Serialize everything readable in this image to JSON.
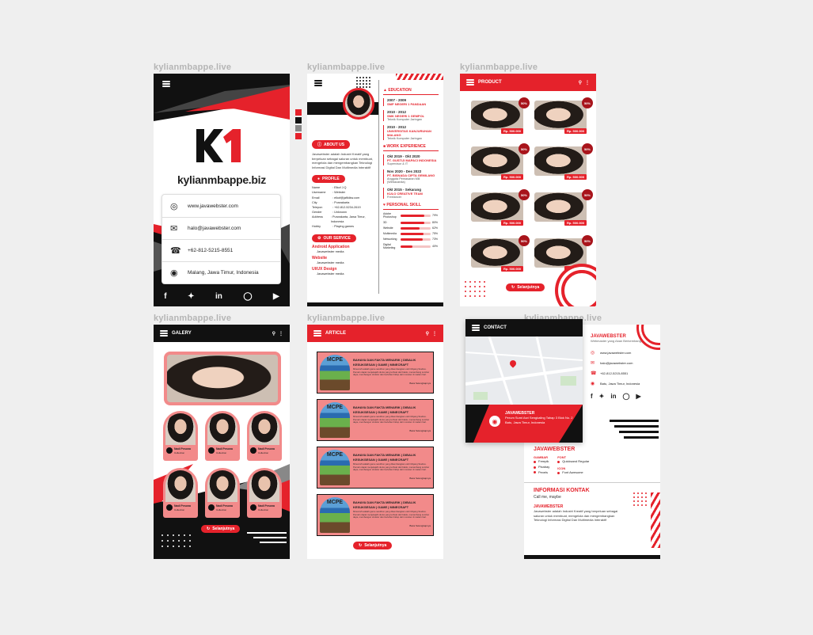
{
  "watermarks": [
    "kylianmbappe.live",
    "kylianmbappe.live",
    "kylianmbappe.live",
    "kylianmbappe.live",
    "kylianmbappe.live",
    "kylianmbappe.live"
  ],
  "card": {
    "logo": "K1",
    "brand": "kylianmbappe.biz",
    "contacts": [
      {
        "icon": "globe-icon",
        "text": "www.javawebster.com"
      },
      {
        "icon": "mail-icon",
        "text": "halo@javawebster.com"
      },
      {
        "icon": "phone-icon",
        "text": "+62-812-5215-8551"
      },
      {
        "icon": "pin-icon",
        "text": "Malang, Jawa Timur, Indonesia"
      }
    ],
    "socials": [
      "facebook-icon",
      "twitter-icon",
      "linkedin-icon",
      "instagram-icon",
      "youtube-icon"
    ]
  },
  "resume": {
    "about_label": "ABOUT US",
    "about_text": "Javawebster adalah Industri Kreatif yang berpeluan sebagai saluran untuk membuat, mengelola dan mengembangkan Teknologi Informasi Digital Dan Multimedia Interaktif",
    "profile_label": "PROFILE",
    "profile": [
      {
        "k": "Name",
        "v": "Elkof J.Q"
      },
      {
        "k": "Username",
        "v": "Webster"
      },
      {
        "k": "Email",
        "v": "elkof@jafikikw.com"
      },
      {
        "k": "City",
        "v": "Purwakarta"
      },
      {
        "k": "Telepon",
        "v": "+62-812-5234-2619"
      },
      {
        "k": "Gender",
        "v": "Unknown"
      },
      {
        "k": "Address",
        "v": "Purwakarta, Jawa Timur, Indonesia"
      },
      {
        "k": "Hobby",
        "v": "Playing games"
      }
    ],
    "service_label": "OUR SERVICE",
    "services": [
      {
        "title": "Android Application",
        "sub": "Javawebster media"
      },
      {
        "title": "Website",
        "sub": "Javawebster media"
      },
      {
        "title": "UI/UX Design",
        "sub": "Javawebster media"
      }
    ],
    "education_label": "EDUCATION",
    "education": [
      {
        "year": "2007 - 2009",
        "school": "SMP NEGERI 1 PANDAAN",
        "note": ""
      },
      {
        "year": "2010 - 2012",
        "school": "SMK NEGERI 1 GEMPOL",
        "note": "Teknik Komputer Jaringan"
      },
      {
        "year": "2010 - 2012",
        "school": "UNIVERSITAS KANJURUHAN MALANG",
        "note": "Teknik Komputer Jaringan"
      }
    ],
    "work_label": "WORK EXPERIENCE",
    "work": [
      {
        "year": "Okt 2019 - Okt 2020",
        "company": "PT. GUSTIJI MAPACI INDONESIA",
        "role": "Supervisor & IT"
      },
      {
        "year": "Nov 2020 - Des 2022",
        "company": "PT. BISNADA CIPTA GEMILANG",
        "role": "Anggota Pemasaran Mill (Webacardia)"
      },
      {
        "year": "Okt 2015 - Sekarang",
        "company": "KULO CREATIVE TEAM",
        "role": "Freelancer"
      }
    ],
    "skill_label": "PERSONAL SKILL",
    "skills": [
      {
        "name": "Adobe Photoshop",
        "pct": "79%",
        "level": 0.79
      },
      {
        "name": "3D",
        "pct": "80%",
        "level": 0.8
      },
      {
        "name": "Website",
        "pct": "62%",
        "level": 0.62
      },
      {
        "name": "Multimedia",
        "pct": "75%",
        "level": 0.75
      },
      {
        "name": "Networking",
        "pct": "73%",
        "level": 0.73
      },
      {
        "name": "Digital Marketing",
        "pct": "40%",
        "level": 0.4
      }
    ]
  },
  "product": {
    "title": "PRODUCT",
    "badge": "50%",
    "price": "Rp. 500.000",
    "more": "Selanjutnya"
  },
  "gallery": {
    "title": "GALERY",
    "caption_title": "Nadi Pesona",
    "caption_sub": "Collection",
    "more": "Selanjutnya"
  },
  "article": {
    "title": "ARTICLE",
    "headline": "BAHAYA DAN FAKTA MENARIK | DIBALIK KESUKSESAN | GAME | MINECRAFT",
    "body": "Minecraft adalah game sandbox yang dikembangkan oleh Mojang Studios. Pemain dapat menjelajahi dunia yang terbuat dari balok, menambang sumber daya, membangun struktur dan bertahan hidup dari monster di malam hari.",
    "more_link": "Baca Selengkapnya",
    "image_label": "MCPE",
    "more": "Selanjutnya"
  },
  "contact": {
    "title": "CONTACT",
    "map_name": "JAVAWEBSTER",
    "map_addr": "Perum Sumi Asri Sengkaling Tahap 3 Blok No. 2 Batu, Jawa Timur, Indonesia",
    "info_name": "JAVAWEBSTER",
    "info_tag": "Webmaster yang Akan Berkembang",
    "info_rows": [
      {
        "icon": "globe-icon",
        "text": "www.javawebster.com"
      },
      {
        "icon": "mail-icon",
        "text": "halo@javawebster.com"
      },
      {
        "icon": "phone-icon",
        "text": "+62-812-5215-8551"
      },
      {
        "icon": "pin-icon",
        "text": "Batu, Jawa Timur, Indonesia"
      }
    ],
    "brand_title": "JAVAWEBSTER",
    "gambar_label": "GAMBAR",
    "gambar": [
      "Freepik",
      "Pixabay",
      "Pexels"
    ],
    "font_label": "FONT",
    "font": [
      "Quicksand Regular"
    ],
    "icon_label": "ICON",
    "icon": [
      "Font Awesome"
    ],
    "info_title": "INFORMASI KONTAK",
    "info_sub": "Call me, maybe",
    "info_brand": "JAVAWEBSTER",
    "info_text": "Javawebster adalah Industri Kreatif yang berpeluan sebagai saluran untuk membuat, mengelola dan mengembangkan Teknologi Informasi Digital Dan Multimedia Interaktif"
  }
}
